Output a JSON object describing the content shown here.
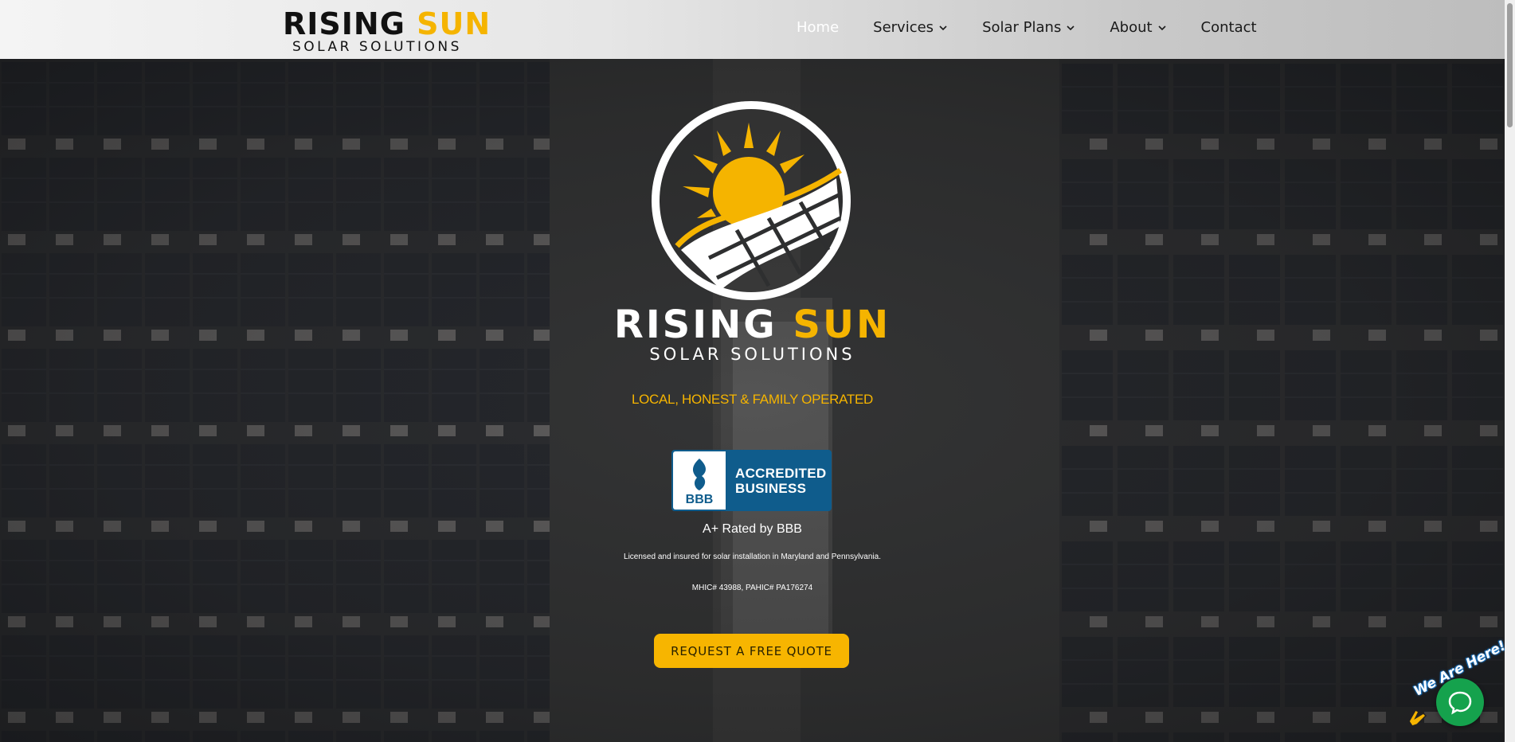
{
  "header": {
    "logo_line1_a": "RISING",
    "logo_line1_b": "SUN",
    "logo_line2": "SOLAR SOLUTIONS"
  },
  "nav": [
    {
      "label": "Home",
      "active": true,
      "dropdown": false
    },
    {
      "label": "Services",
      "active": false,
      "dropdown": true
    },
    {
      "label": "Solar Plans",
      "active": false,
      "dropdown": true
    },
    {
      "label": "About",
      "active": false,
      "dropdown": true
    },
    {
      "label": "Contact",
      "active": false,
      "dropdown": false
    }
  ],
  "hero": {
    "brand_a": "RISING",
    "brand_b": "SUN",
    "brand_sub": "SOLAR SOLUTIONS",
    "tagline": "LOCAL, HONEST & FAMILY OPERATED",
    "bbb_mark": "BBB",
    "bbb_line1": "ACCREDITED",
    "bbb_line2": "BUSINESS",
    "rating": "A+ Rated by BBB",
    "licensed": "Licensed and insured for solar installation in Maryland and Pennsylvania.",
    "license_numbers": "MHIC# 43988, PAHIC# PA176274",
    "cta_label": "REQUEST A FREE QUOTE"
  },
  "chat": {
    "label": "We Are Here!"
  },
  "colors": {
    "accent": "#f5b400",
    "bbb_blue": "#0f5c8c",
    "chat_green": "#15a24d"
  }
}
